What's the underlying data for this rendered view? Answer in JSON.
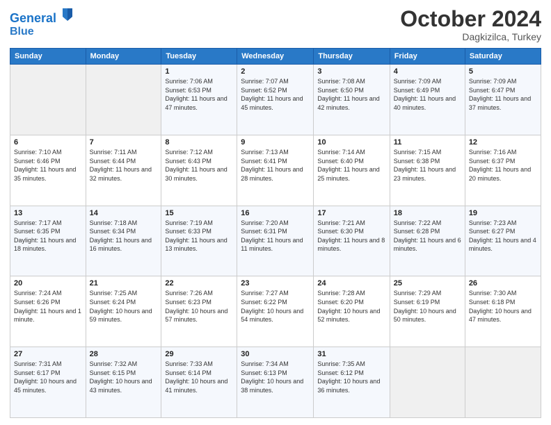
{
  "header": {
    "logo_line1": "General",
    "logo_line2": "Blue",
    "month": "October 2024",
    "location": "Dagkizilca, Turkey"
  },
  "weekdays": [
    "Sunday",
    "Monday",
    "Tuesday",
    "Wednesday",
    "Thursday",
    "Friday",
    "Saturday"
  ],
  "weeks": [
    [
      {
        "day": "",
        "info": ""
      },
      {
        "day": "",
        "info": ""
      },
      {
        "day": "1",
        "info": "Sunrise: 7:06 AM\nSunset: 6:53 PM\nDaylight: 11 hours and 47 minutes."
      },
      {
        "day": "2",
        "info": "Sunrise: 7:07 AM\nSunset: 6:52 PM\nDaylight: 11 hours and 45 minutes."
      },
      {
        "day": "3",
        "info": "Sunrise: 7:08 AM\nSunset: 6:50 PM\nDaylight: 11 hours and 42 minutes."
      },
      {
        "day": "4",
        "info": "Sunrise: 7:09 AM\nSunset: 6:49 PM\nDaylight: 11 hours and 40 minutes."
      },
      {
        "day": "5",
        "info": "Sunrise: 7:09 AM\nSunset: 6:47 PM\nDaylight: 11 hours and 37 minutes."
      }
    ],
    [
      {
        "day": "6",
        "info": "Sunrise: 7:10 AM\nSunset: 6:46 PM\nDaylight: 11 hours and 35 minutes."
      },
      {
        "day": "7",
        "info": "Sunrise: 7:11 AM\nSunset: 6:44 PM\nDaylight: 11 hours and 32 minutes."
      },
      {
        "day": "8",
        "info": "Sunrise: 7:12 AM\nSunset: 6:43 PM\nDaylight: 11 hours and 30 minutes."
      },
      {
        "day": "9",
        "info": "Sunrise: 7:13 AM\nSunset: 6:41 PM\nDaylight: 11 hours and 28 minutes."
      },
      {
        "day": "10",
        "info": "Sunrise: 7:14 AM\nSunset: 6:40 PM\nDaylight: 11 hours and 25 minutes."
      },
      {
        "day": "11",
        "info": "Sunrise: 7:15 AM\nSunset: 6:38 PM\nDaylight: 11 hours and 23 minutes."
      },
      {
        "day": "12",
        "info": "Sunrise: 7:16 AM\nSunset: 6:37 PM\nDaylight: 11 hours and 20 minutes."
      }
    ],
    [
      {
        "day": "13",
        "info": "Sunrise: 7:17 AM\nSunset: 6:35 PM\nDaylight: 11 hours and 18 minutes."
      },
      {
        "day": "14",
        "info": "Sunrise: 7:18 AM\nSunset: 6:34 PM\nDaylight: 11 hours and 16 minutes."
      },
      {
        "day": "15",
        "info": "Sunrise: 7:19 AM\nSunset: 6:33 PM\nDaylight: 11 hours and 13 minutes."
      },
      {
        "day": "16",
        "info": "Sunrise: 7:20 AM\nSunset: 6:31 PM\nDaylight: 11 hours and 11 minutes."
      },
      {
        "day": "17",
        "info": "Sunrise: 7:21 AM\nSunset: 6:30 PM\nDaylight: 11 hours and 8 minutes."
      },
      {
        "day": "18",
        "info": "Sunrise: 7:22 AM\nSunset: 6:28 PM\nDaylight: 11 hours and 6 minutes."
      },
      {
        "day": "19",
        "info": "Sunrise: 7:23 AM\nSunset: 6:27 PM\nDaylight: 11 hours and 4 minutes."
      }
    ],
    [
      {
        "day": "20",
        "info": "Sunrise: 7:24 AM\nSunset: 6:26 PM\nDaylight: 11 hours and 1 minute."
      },
      {
        "day": "21",
        "info": "Sunrise: 7:25 AM\nSunset: 6:24 PM\nDaylight: 10 hours and 59 minutes."
      },
      {
        "day": "22",
        "info": "Sunrise: 7:26 AM\nSunset: 6:23 PM\nDaylight: 10 hours and 57 minutes."
      },
      {
        "day": "23",
        "info": "Sunrise: 7:27 AM\nSunset: 6:22 PM\nDaylight: 10 hours and 54 minutes."
      },
      {
        "day": "24",
        "info": "Sunrise: 7:28 AM\nSunset: 6:20 PM\nDaylight: 10 hours and 52 minutes."
      },
      {
        "day": "25",
        "info": "Sunrise: 7:29 AM\nSunset: 6:19 PM\nDaylight: 10 hours and 50 minutes."
      },
      {
        "day": "26",
        "info": "Sunrise: 7:30 AM\nSunset: 6:18 PM\nDaylight: 10 hours and 47 minutes."
      }
    ],
    [
      {
        "day": "27",
        "info": "Sunrise: 7:31 AM\nSunset: 6:17 PM\nDaylight: 10 hours and 45 minutes."
      },
      {
        "day": "28",
        "info": "Sunrise: 7:32 AM\nSunset: 6:15 PM\nDaylight: 10 hours and 43 minutes."
      },
      {
        "day": "29",
        "info": "Sunrise: 7:33 AM\nSunset: 6:14 PM\nDaylight: 10 hours and 41 minutes."
      },
      {
        "day": "30",
        "info": "Sunrise: 7:34 AM\nSunset: 6:13 PM\nDaylight: 10 hours and 38 minutes."
      },
      {
        "day": "31",
        "info": "Sunrise: 7:35 AM\nSunset: 6:12 PM\nDaylight: 10 hours and 36 minutes."
      },
      {
        "day": "",
        "info": ""
      },
      {
        "day": "",
        "info": ""
      }
    ]
  ]
}
